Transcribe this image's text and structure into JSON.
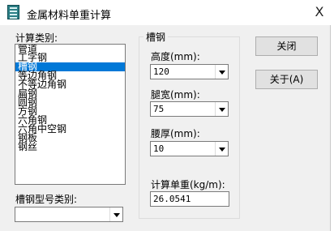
{
  "window": {
    "title": "金属材料单重计算",
    "close_glyph": "X",
    "icon": "calculator-app-icon"
  },
  "category": {
    "label": "计算类别:",
    "items": [
      "管道",
      "工字钢",
      "槽钢",
      "等边角钢",
      "不等边角钢",
      "扁钢",
      "圆钢",
      "方钢",
      "六角钢",
      "六角中空钢",
      "钢板",
      "钢丝"
    ],
    "selected": "槽钢"
  },
  "type_select": {
    "label": "槽钢型号类别:",
    "value": ""
  },
  "params": {
    "group_title": "槽钢",
    "height_label": "高度(mm):",
    "height_value": "120",
    "leg_width_label": "腿宽(mm):",
    "leg_width_value": "75",
    "waist_thickness_label": "腰厚(mm):",
    "waist_thickness_value": "10",
    "unit_weight_label": "计算单重(kg/m):",
    "unit_weight_value": "26.0541"
  },
  "buttons": {
    "close_label": "关闭",
    "about_label": "关于(A)"
  }
}
